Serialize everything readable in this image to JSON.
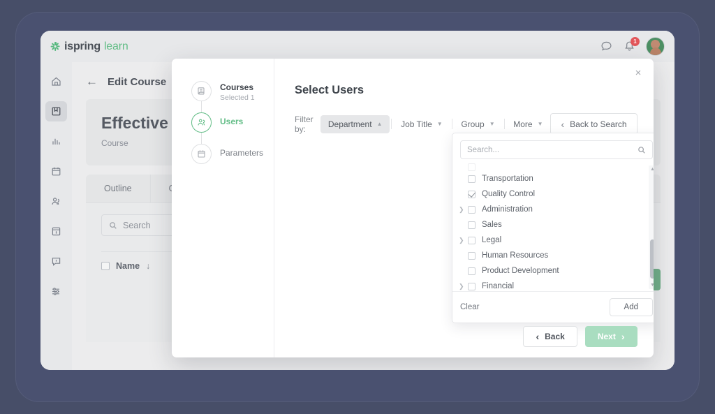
{
  "app": {
    "logo_dark": "ispring",
    "logo_green": "learn",
    "notifications_badge": "1"
  },
  "topbar_icons": [
    {
      "name": "chat-icon"
    },
    {
      "name": "bell-icon"
    }
  ],
  "sidebar": {
    "items": [
      {
        "name": "home",
        "active": false
      },
      {
        "name": "courses",
        "active": true
      },
      {
        "name": "reports",
        "active": false
      },
      {
        "name": "calendar",
        "active": false
      },
      {
        "name": "users",
        "active": false
      },
      {
        "name": "news",
        "active": false
      },
      {
        "name": "support",
        "active": false
      },
      {
        "name": "settings",
        "active": false
      }
    ]
  },
  "page": {
    "back_label": "←",
    "title": "Edit Course",
    "course_title": "Effective Ne",
    "course_subtitle": "Course",
    "tabs": [
      {
        "label": "Outline"
      },
      {
        "label": "Genera"
      }
    ],
    "search_placeholder": "Search",
    "table_header": "Name",
    "sort_arrow": "↓"
  },
  "modal": {
    "close_label": "×",
    "title": "Select Users",
    "steps": [
      {
        "label": "Courses",
        "sub": "Selected 1",
        "icon": "course-icon",
        "active": false
      },
      {
        "label": "Users",
        "sub": "",
        "icon": "users-icon",
        "active": true
      },
      {
        "label": "Parameters",
        "sub": "",
        "icon": "calendar-icon",
        "active": false
      }
    ],
    "filter": {
      "label": "Filter by:",
      "chips": [
        {
          "label": "Department",
          "caret": "⌃",
          "active": true
        },
        {
          "label": "Job Title",
          "caret": "⌄",
          "active": false
        },
        {
          "label": "Group",
          "caret": "⌄",
          "active": false
        },
        {
          "label": "More",
          "caret": "⌄",
          "active": false
        }
      ],
      "back_to_search": "Back to Search",
      "back_chevron": "‹"
    },
    "dropdown": {
      "search_placeholder": "Search...",
      "items": [
        {
          "label": "Transportation",
          "checked": false,
          "expandable": false
        },
        {
          "label": "Quality Control",
          "checked": true,
          "expandable": false
        },
        {
          "label": "Administration",
          "checked": false,
          "expandable": true
        },
        {
          "label": "Sales",
          "checked": false,
          "expandable": false
        },
        {
          "label": "Legal",
          "checked": false,
          "expandable": true
        },
        {
          "label": "Human Resources",
          "checked": false,
          "expandable": false
        },
        {
          "label": "Product Development",
          "checked": false,
          "expandable": false
        },
        {
          "label": "Financial",
          "checked": false,
          "expandable": true
        }
      ],
      "clear_label": "Clear",
      "add_label": "Add",
      "scroll_up": "▲",
      "scroll_down": "▼"
    },
    "footer": {
      "back_label": "Back",
      "back_chevron": "‹",
      "next_label": "Next",
      "next_chevron": "›"
    }
  },
  "colors": {
    "accent_green": "#63bd87",
    "primary_disabled": "#a9ddc0",
    "badge_red": "#e2565a",
    "frame": "#474e68"
  }
}
